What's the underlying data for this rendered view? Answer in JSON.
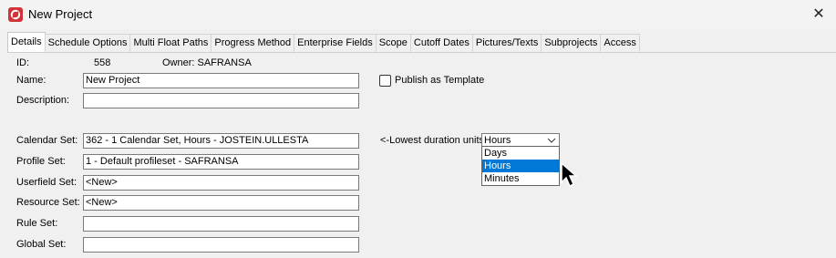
{
  "window": {
    "title": "New Project",
    "icon": "safran-logo-icon",
    "close_glyph": "✕"
  },
  "tabs": [
    {
      "label": "Details",
      "active": true
    },
    {
      "label": "Schedule Options"
    },
    {
      "label": "Multi Float Paths"
    },
    {
      "label": "Progress Method"
    },
    {
      "label": "Enterprise Fields"
    },
    {
      "label": "Scope"
    },
    {
      "label": "Cutoff Dates"
    },
    {
      "label": "Pictures/Texts"
    },
    {
      "label": "Subprojects"
    },
    {
      "label": "Access"
    }
  ],
  "details": {
    "id_label": "ID:",
    "id_value": "558",
    "owner_label": "Owner: SAFRANSA",
    "name_label": "Name:",
    "name_value": "New Project",
    "description_label": "Description:",
    "description_value": "",
    "publish_label": "Publish as Template",
    "calendar_label": "Calendar Set:",
    "calendar_value": "362 - 1 Calendar Set, Hours - JOSTEIN.ULLESTA",
    "profile_label": "Profile Set:",
    "profile_value": "1 - Default profileset - SAFRANSA",
    "userfield_label": "Userfield Set:",
    "userfield_value": "<New>",
    "resource_label": "Resource Set:",
    "resource_value": "<New>",
    "rule_label": "Rule Set:",
    "rule_value": "",
    "global_label": "Global Set:",
    "global_value": ""
  },
  "duration": {
    "label": "<-Lowest duration units",
    "selected": "Hours",
    "options": [
      "Days",
      "Hours",
      "Minutes"
    ]
  }
}
